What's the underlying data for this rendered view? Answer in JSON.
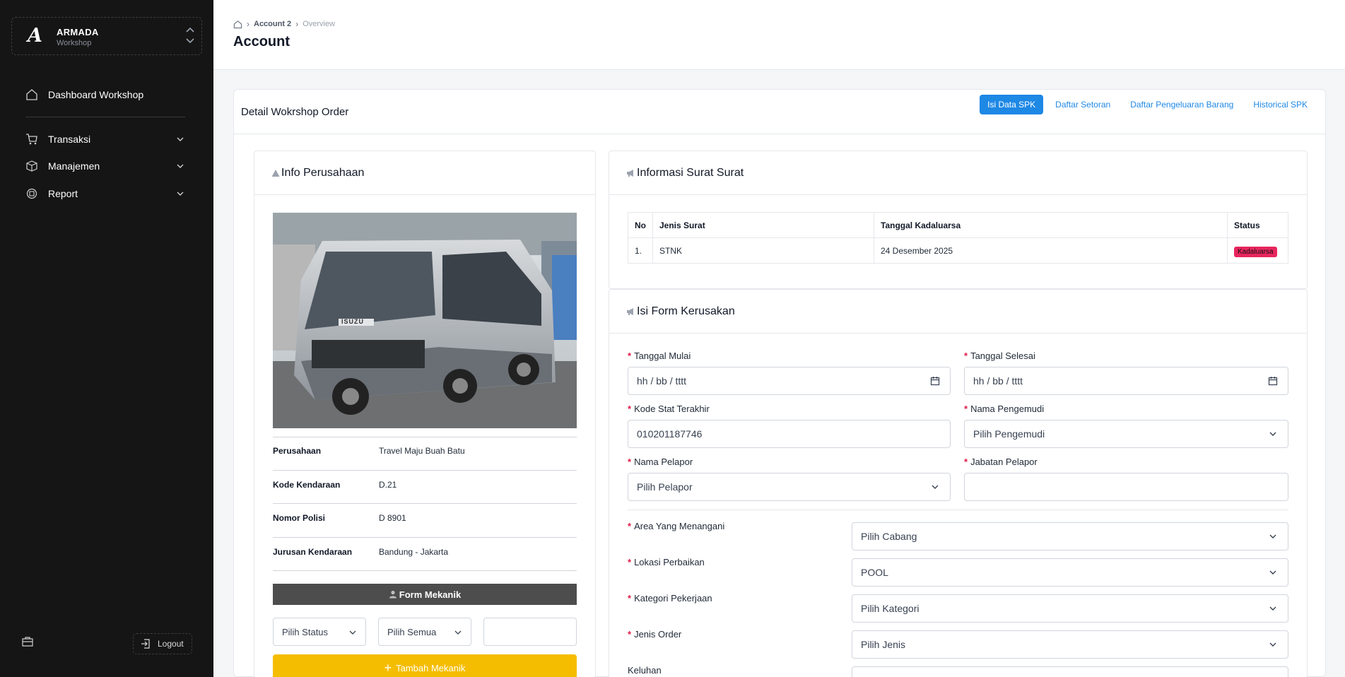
{
  "brand": {
    "name": "ARMADA",
    "sub": "Workshop",
    "logo": "A"
  },
  "sidebar": {
    "items": [
      {
        "label": "Dashboard Workshop",
        "icon": "home-icon"
      },
      {
        "label": "Transaksi",
        "icon": "cart-icon"
      },
      {
        "label": "Manajemen",
        "icon": "box-icon"
      },
      {
        "label": "Report",
        "icon": "report-icon"
      }
    ],
    "logout_label": "Logout"
  },
  "header": {
    "breadcrumb": [
      "Account 2",
      "Overview"
    ],
    "title": "Account"
  },
  "main": {
    "title": "Detail Wokrshop Order",
    "tabs": [
      {
        "label": "Isi Data SPK",
        "active": true
      },
      {
        "label": "Daftar Setoran",
        "active": false
      },
      {
        "label": "Daftar Pengeluaran Barang",
        "active": false
      },
      {
        "label": "Historical SPK",
        "active": false
      }
    ]
  },
  "info": {
    "title": "Info Perusahaan",
    "rows": [
      {
        "label": "Perusahaan",
        "value": "Travel Maju Buah Batu"
      },
      {
        "label": "Kode Kendaraan",
        "value": "D.21"
      },
      {
        "label": "Nomor Polisi",
        "value": "D 8901"
      },
      {
        "label": "Jurusan Kendaraan",
        "value": "Bandung - Jakarta"
      }
    ],
    "vehicle_brand": "ISUZU",
    "form_mekanik_label": "Form Mekanik",
    "status_select": "Pilih Status",
    "semua_select": "Pilih Semua",
    "tambah_label": "Tambah Mekanik"
  },
  "surat": {
    "title": "Informasi Surat Surat",
    "headers": [
      "No",
      "Jenis Surat",
      "Tanggal Kadaluarsa",
      "Status"
    ],
    "rows": [
      {
        "no": "1.",
        "jenis": "STNK",
        "tanggal": "24 Desember 2025",
        "status": "Kadaluarsa"
      }
    ]
  },
  "form": {
    "title": "Isi Form Kerusakan",
    "tanggal_mulai": {
      "label": "Tanggal Mulai",
      "value": "hh / bb / tttt"
    },
    "tanggal_selesai": {
      "label": "Tanggal Selesai",
      "value": "hh / bb / tttt"
    },
    "kode_stat": {
      "label": "Kode Stat Terakhir",
      "value": "010201187746"
    },
    "nama_pengemudi": {
      "label": "Nama Pengemudi",
      "value": "Pilih Pengemudi"
    },
    "nama_pelapor": {
      "label": "Nama Pelapor",
      "value": "Pilih Pelapor"
    },
    "jabatan_pelapor": {
      "label": "Jabatan Pelapor",
      "value": ""
    },
    "area": {
      "label": "Area Yang Menangani",
      "value": "Pilih Cabang"
    },
    "lokasi": {
      "label": "Lokasi Perbaikan",
      "value": "POOL"
    },
    "kategori": {
      "label": "Kategori Pekerjaan",
      "value": "Pilih Kategori"
    },
    "jenis_order": {
      "label": "Jenis Order",
      "value": "Pilih Jenis"
    },
    "keluhan": {
      "label": "Keluhan",
      "value": ""
    },
    "required_mark": "*"
  },
  "colors": {
    "sidebar_bg": "#151515",
    "primary": "#1e88e5",
    "badge": "#e8265e",
    "tambah": "#f5bd00",
    "form_mekanik": "#4d4d4d"
  }
}
